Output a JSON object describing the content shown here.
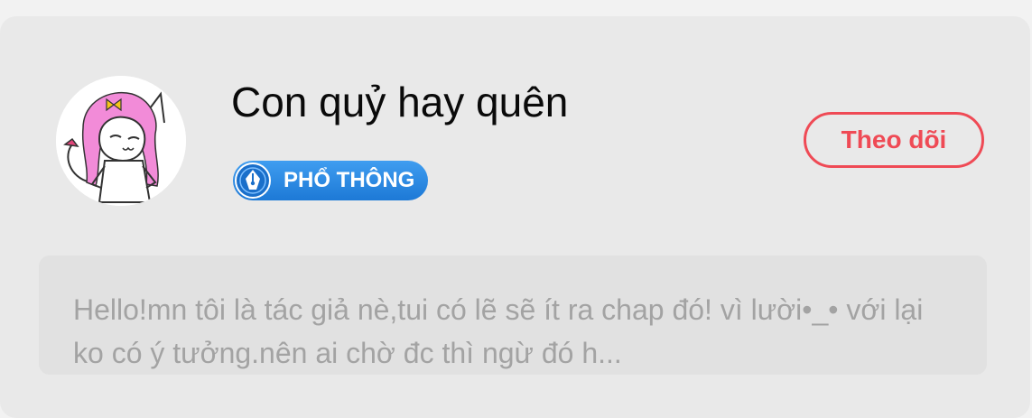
{
  "author": {
    "name": "Con quỷ hay quên",
    "avatar_icon": "chibi-pink-hair-cat-avatar"
  },
  "badge": {
    "label": "PHỔ THÔNG",
    "icon": "fountain-pen-nib-icon",
    "color": "#2a86e0"
  },
  "follow": {
    "label": "Theo dõi",
    "color": "#ef4a55"
  },
  "bio": {
    "text": "Hello!mn tôi là tác giả nè,tui có lẽ sẽ ít ra chap đó! vì lười•_• với lại ko có ý tưởng.nên ai chờ đc thì ngừ đó h..."
  }
}
